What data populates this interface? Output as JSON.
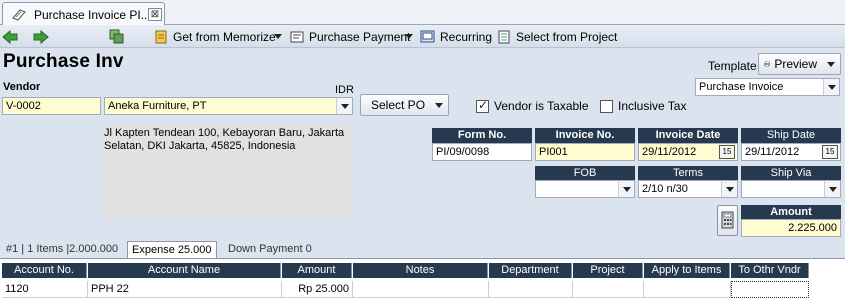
{
  "tab": {
    "title": "Purchase Invoice  PI...",
    "close_label": "⊠"
  },
  "toolbar": {
    "memorize_label": "Get from Memorize",
    "payment_label": "Purchase Payment",
    "recurring_label": "Recurring",
    "project_label": "Select from Project"
  },
  "header": {
    "title": "Purchase Inv",
    "template_label": "Template",
    "preview_label": "Preview",
    "template_value": "Purchase Invoice",
    "vendor_label": "Vendor",
    "currency": "IDR",
    "vendor_code": "V-0002",
    "vendor_name": "Aneka Furniture, PT",
    "select_po_label": "Select PO",
    "vendor_taxable_label": "Vendor is Taxable",
    "vendor_taxable_checked": true,
    "inclusive_tax_label": "Inclusive Tax",
    "inclusive_tax_checked": false,
    "address_line1": "Jl Kapten Tendean 100, Kebayoran Baru, Jakarta",
    "address_line2": "Selatan, DKI Jakarta, 45825, Indonesia"
  },
  "form": {
    "form_no_label": "Form No.",
    "form_no": "PI/09/0098",
    "invoice_no_label": "Invoice No.",
    "invoice_no": "PI001",
    "invoice_date_label": "Invoice Date",
    "invoice_date": "29/11/2012",
    "ship_date_label": "Ship Date",
    "ship_date": "29/11/2012",
    "fob_label": "FOB",
    "fob": "",
    "terms_label": "Terms",
    "terms": "2/10 n/30",
    "ship_via_label": "Ship Via",
    "ship_via": "",
    "amount_label": "Amount",
    "amount": "2.225.000",
    "calendar_glyph": "15"
  },
  "detail_tabs": [
    {
      "label": "#1 | 1 Items |2.000.000"
    },
    {
      "label": "Expense   25.000"
    },
    {
      "label": "Down Payment   0"
    }
  ],
  "grid": {
    "columns": [
      "Account No.",
      "Account Name",
      "Amount",
      "Notes",
      "Department",
      "Project",
      "Apply to Items",
      "To Othr Vndr"
    ],
    "rows": [
      [
        "1120",
        "PPH 22",
        "Rp 25.000",
        "",
        "",
        "",
        "",
        ""
      ]
    ]
  },
  "colors": {
    "header_bg": "#26394f",
    "required_field": "#fefcd0",
    "form_bg": "#dbe3ee"
  }
}
